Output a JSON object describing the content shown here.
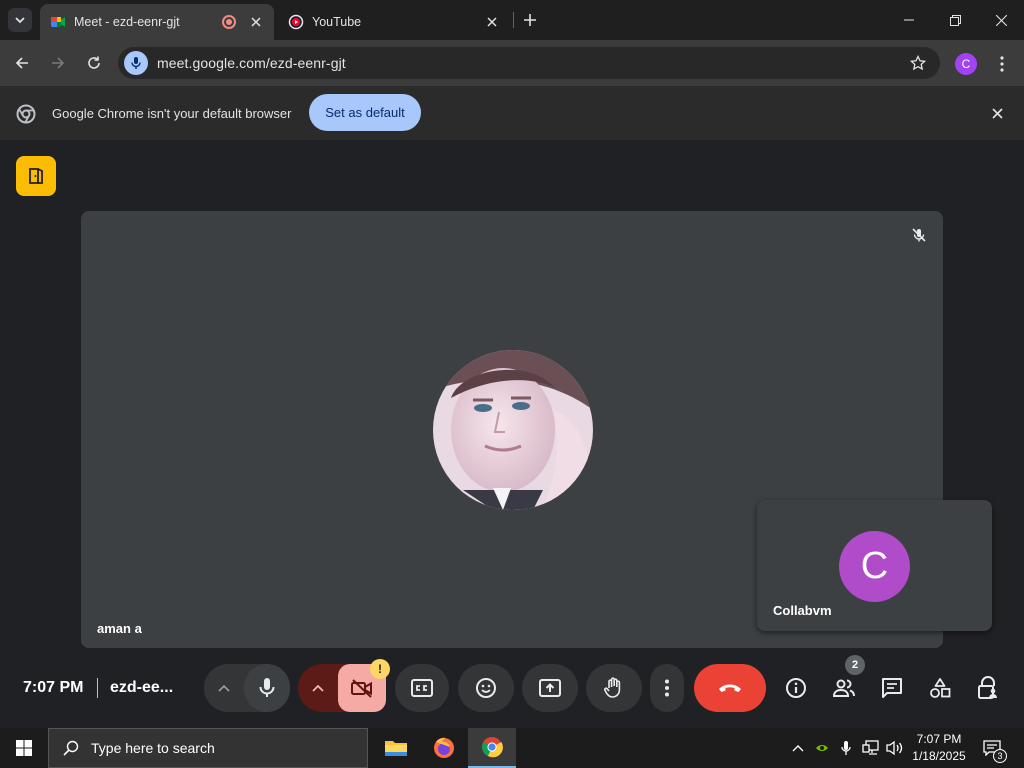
{
  "browser": {
    "tabs": [
      {
        "title": "Meet - ezd-eenr-gjt",
        "active": true
      },
      {
        "title": "YouTube",
        "active": false
      }
    ],
    "url": "meet.google.com/ezd-eenr-gjt",
    "profile_initial": "C"
  },
  "infobar": {
    "message": "Google Chrome isn't your default browser",
    "button_label": "Set as default"
  },
  "meet": {
    "main_participant": "aman a",
    "self_participant": "Collabvm",
    "self_initial": "C",
    "time": "7:07 PM",
    "meeting_code": "ezd-ee...",
    "camera_warning": "!",
    "people_count": "2",
    "colors": {
      "end_call": "#ea4335",
      "camera_off": "#f5aaa5",
      "self_avatar": "#b04bc9",
      "companion": "#fbbc04"
    }
  },
  "taskbar": {
    "search_placeholder": "Type here to search",
    "time": "7:07 PM",
    "date": "1/18/2025",
    "notification_count": "3"
  }
}
